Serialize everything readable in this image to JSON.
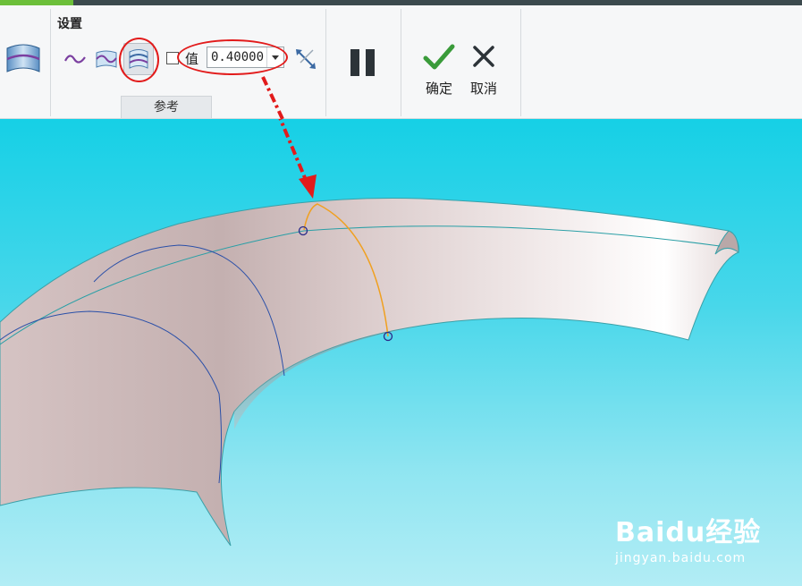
{
  "ribbon": {
    "group_title": "设置",
    "value_label": "值",
    "value_input": "0.40000",
    "reference_tab": "参考",
    "ok_label": "确定",
    "cancel_label": "取消"
  },
  "icons": {
    "fill_surface": "surface-patch-icon",
    "curve": "wavy-curve-icon",
    "surface_ref": "surface-curve-icon",
    "offset_surface": "offset-surface-icon",
    "flip": "flip-direction-icon",
    "pause": "pause-icon",
    "ok": "check-icon",
    "cancel": "close-icon"
  },
  "watermark": {
    "brand": "Baidu经验",
    "url": "jingyan.baidu.com"
  },
  "colors": {
    "annotation": "#e21b1b",
    "viewport_top": "#16d0e6",
    "viewport_bottom": "#b2edf5",
    "accent_green": "#6cbf3a"
  }
}
